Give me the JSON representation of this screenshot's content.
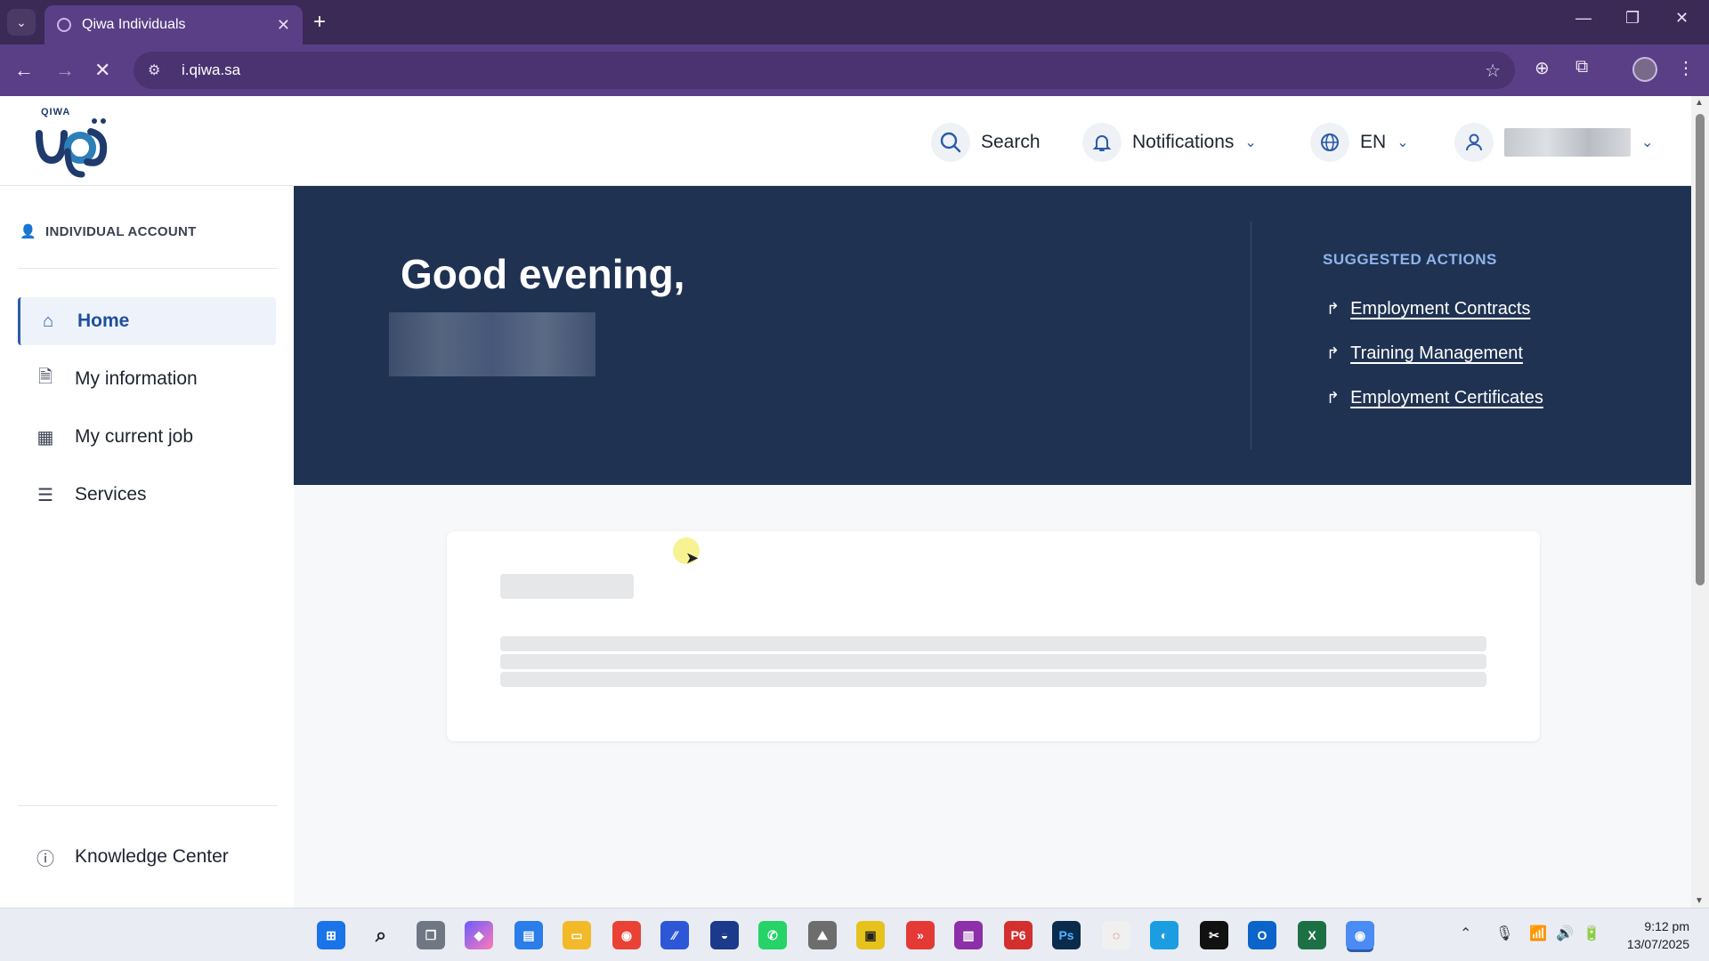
{
  "browser": {
    "tab_title": "Qiwa Individuals",
    "url": "i.qiwa.sa",
    "new_tab_glyph": "+",
    "tab_close_glyph": "✕"
  },
  "header": {
    "logo_brand": "QIWA",
    "search_label": "Search",
    "notifications_label": "Notifications",
    "language_label": "EN"
  },
  "sidebar": {
    "account_label": "INDIVIDUAL ACCOUNT",
    "items": [
      {
        "label": "Home",
        "icon": "home-icon",
        "active": true
      },
      {
        "label": "My information",
        "icon": "document-icon",
        "active": false
      },
      {
        "label": "My current job",
        "icon": "building-icon",
        "active": false
      },
      {
        "label": "Services",
        "icon": "services-icon",
        "active": false
      }
    ],
    "knowledge_center_label": "Knowledge Center"
  },
  "hero": {
    "greeting": "Good evening,",
    "suggested_title": "SUGGESTED ACTIONS",
    "suggested_actions": [
      {
        "label": "Employment Contracts"
      },
      {
        "label": "Training Management"
      },
      {
        "label": "Employment Certificates"
      }
    ]
  },
  "taskbar": {
    "time": "9:12 pm",
    "date": "13/07/2025"
  },
  "colors": {
    "hero_bg": "#1f3252",
    "accent": "#2c5ba8",
    "browser_chrome": "#5a3f86"
  }
}
